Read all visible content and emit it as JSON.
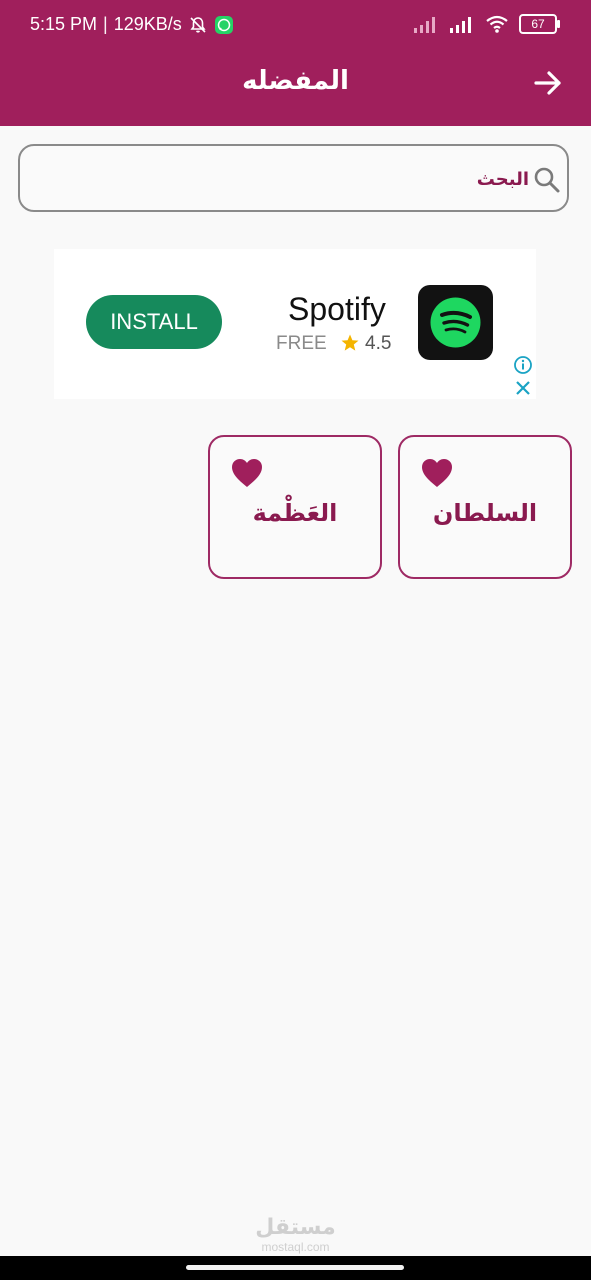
{
  "status_bar": {
    "time": "5:15 PM",
    "separator": "|",
    "network_speed": "129KB/s",
    "battery_level": "67",
    "icons": [
      "bell-off-icon",
      "whatsapp-icon",
      "signal-icon",
      "signal-icon",
      "wifi-icon",
      "battery-icon"
    ]
  },
  "header": {
    "title": "المفضله",
    "back_icon": "arrow-right-icon",
    "background_color": "#a01f5c"
  },
  "search": {
    "placeholder": "البحث",
    "icon": "search-icon"
  },
  "ad": {
    "install_label": "INSTALL",
    "app_name": "Spotify",
    "price": "FREE",
    "rating": "4.5",
    "icons": [
      "spotify-logo-icon",
      "star-icon",
      "info-icon",
      "close-icon"
    ],
    "install_color": "#168a5c"
  },
  "favorites": [
    {
      "title": "السلطان",
      "icon": "heart-icon"
    },
    {
      "title": "العَظْمة",
      "icon": "heart-icon"
    }
  ],
  "watermark": {
    "arabic": "مستقل",
    "latin": "mostaql.com"
  },
  "colors": {
    "accent": "#9e2a64",
    "card_text": "#8a1a4f",
    "background": "#f9f9f9"
  }
}
